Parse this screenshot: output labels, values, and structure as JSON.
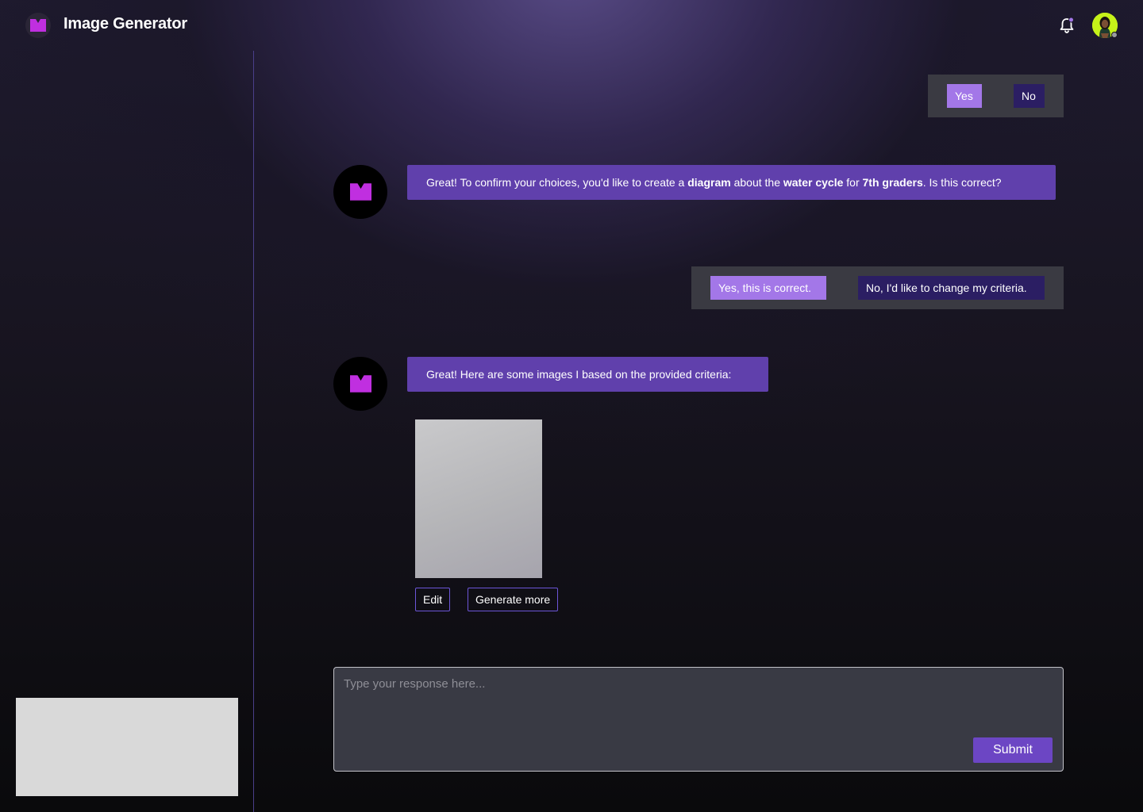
{
  "header": {
    "app_title": "Image Generator",
    "logo_icon": "m-logo-icon",
    "notification_icon": "bell-icon",
    "avatar_icon": "user-avatar"
  },
  "colors": {
    "accent": "#6040ac",
    "accent_light": "#a377e8",
    "accent_dark": "#2b1e63",
    "logo": "#c02fe0",
    "avatar_bg": "#c6f219"
  },
  "chat": {
    "option_set_1": {
      "yes_label": "Yes",
      "no_label": "No"
    },
    "bot_message_1": {
      "p1": "Great! To confirm your choices, you'd like to create a ",
      "b1": "diagram",
      "p2": " about the ",
      "b2": "water cycle",
      "p3": " for ",
      "b3": "7th graders",
      "p4": ". Is this correct?"
    },
    "option_set_2": {
      "confirm_label": "Yes, this is correct.",
      "change_label": "No, I'd like to change my criteria."
    },
    "bot_message_2": {
      "text": "Great! Here are some images I based on the provided criteria:"
    },
    "image_actions": {
      "edit_label": "Edit",
      "generate_label": "Generate more"
    }
  },
  "composer": {
    "placeholder": "Type your response here...",
    "submit_label": "Submit"
  }
}
